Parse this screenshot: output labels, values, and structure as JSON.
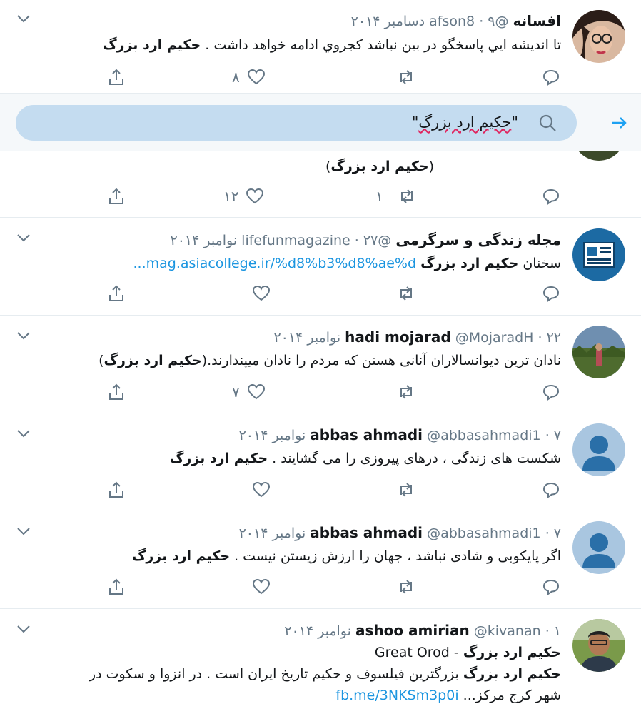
{
  "search": {
    "query_open": "\"",
    "query_main": "حکیم ارد بزرگ",
    "query_close": "\""
  },
  "tweets": [
    {
      "name": "افسانه",
      "handle": "@afson8",
      "dot": "·",
      "date": "۹ دسامبر ۲۰۱۴",
      "line1_pre": "تا اندیشه ايي پاسخگو در بین نباشد کجروي ادامه خواهد داشت . ",
      "line1_bold": "حکیم ارد بزرگ",
      "likes": "۸",
      "retweets": ""
    },
    {
      "line1_pre": "(",
      "line1_bold": "حکیم ارد بزرگ",
      "line1_post": ")",
      "likes": "۱۲",
      "retweets": "۱"
    },
    {
      "name": "مجله زندگی و سرگرمی",
      "handle": "@lifefunmagazine",
      "dot": "·",
      "date": "۲۷ نوامبر ۲۰۱۴",
      "line1_pre": "سخنان ",
      "line1_bold": "حکیم ارد بزرگ",
      "line1_link": "mag.asiacollege.ir/%d8%b3%d8%ae%d...",
      "likes": "",
      "retweets": ""
    },
    {
      "name": "hadi mojarad",
      "handle": "@MojaradH",
      "dot": "·",
      "date": "۲۲ نوامبر ۲۰۱۴",
      "line1_pre": "نادان ترین دیوانسالاران آنانی هستن که مردم را نادان میپندارند.(",
      "line1_bold": "حکیم ارد بزرگ",
      "line1_post": ")",
      "likes": "۷",
      "retweets": ""
    },
    {
      "name": "abbas ahmadi",
      "handle": "@abbasahmadi1",
      "dot": "·",
      "date": "۷ نوامبر ۲۰۱۴",
      "line1_pre": "شکست های زندگی ، درهای پیروزی را می گشایند .  ",
      "line1_bold": "حکیم ارد بزرگ",
      "likes": "",
      "retweets": ""
    },
    {
      "name": "abbas ahmadi",
      "handle": "@abbasahmadi1",
      "dot": "·",
      "date": "۷ نوامبر ۲۰۱۴",
      "line1_pre": "اگر پایکوبی و شادی نباشد ، جهان را ارزش زیستن نیست . ",
      "line1_bold": "حکیم ارد بزرگ",
      "likes": "",
      "retweets": ""
    },
    {
      "name": "ashoo amirian",
      "handle": "@kivanan",
      "dot": "·",
      "date": "۱ نوامبر ۲۰۱۴",
      "line1_bold": "حکیم ارد بزرگ",
      "line1_post": " - Great Orod",
      "line2_bold": "حکیم ارد بزرگ",
      "line2_post": " بزرگترین فیلسوف و حکیم تاریخ ایران است . در انزوا و سکوت در",
      "line3_pre": "شهر کرج مرکز... ",
      "line3_link": "fb.me/3NKSm3p0i"
    }
  ],
  "colors": {
    "accent": "#1da1f2",
    "muted": "#657786",
    "link": "#1b95e0"
  }
}
